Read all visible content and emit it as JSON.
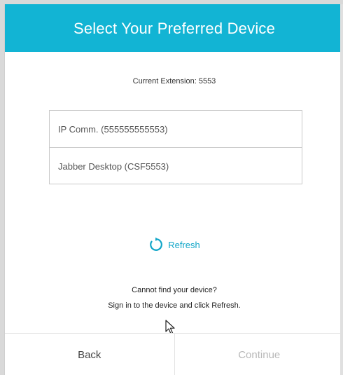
{
  "header": {
    "title": "Select Your Preferred Device",
    "background_color": "#12b4d4"
  },
  "extension": {
    "text": "Current Extension: 5553"
  },
  "devices": [
    {
      "label": "IP Comm. (555555555553)"
    },
    {
      "label": "Jabber Desktop (CSF5553)"
    }
  ],
  "refresh": {
    "label": "Refresh",
    "icon": "refresh-icon",
    "color": "#12a6c8"
  },
  "help": {
    "line1": "Cannot find your device?",
    "line2": "Sign in to the device and click Refresh."
  },
  "footer": {
    "back_label": "Back",
    "continue_label": "Continue",
    "continue_color": "#b8b8b8"
  }
}
